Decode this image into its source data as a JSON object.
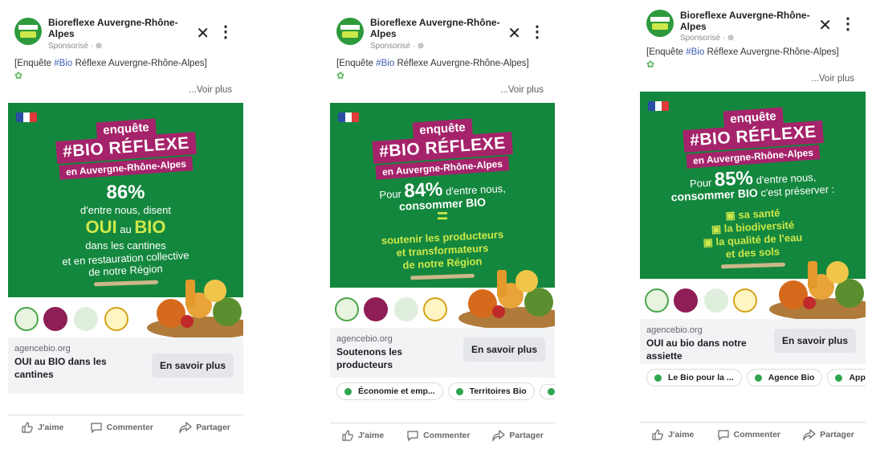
{
  "page_name": "Bioreflexe Auvergne-Rhône-Alpes",
  "sponsored": "Sponsorisé · ⊕",
  "post_text_prefix": "[Enquête ",
  "post_text_hashtag": "#Bio",
  "post_text_suffix": " Réflexe Auvergne-Rhône-Alpes]",
  "see_more": "...Voir plus",
  "close_glyph": "✕",
  "menu_glyph": "⋮",
  "leaf_glyph": "✿",
  "ad_common": {
    "enquete": "enquête",
    "bio_reflexe": "#BIO RÉFLEXE",
    "region": "en Auvergne-Rhône-Alpes"
  },
  "cards": [
    {
      "ad": {
        "percent": "86%",
        "l1": "d'entre nous, disent",
        "oui": "OUI",
        "au": "au",
        "bio": "BIO",
        "l3": "dans les cantines",
        "l4": "et en restauration collective",
        "l5": "de notre Région"
      },
      "link": {
        "domain": "agencebio.org",
        "headline": "OUI au BIO dans les cantines",
        "cta": "En savoir plus"
      }
    },
    {
      "ad": {
        "pour": "Pour",
        "percent": "84%",
        "l1": "d'entre nous,",
        "l2": "consommer BIO",
        "equals": "=",
        "g1": "soutenir les producteurs",
        "g2": "et transformateurs",
        "g3": "de notre Région"
      },
      "link": {
        "domain": "agencebio.org",
        "headline": "Soutenons les producteurs",
        "cta": "En savoir plus"
      },
      "chips": [
        "Économie et emp...",
        "Territoires Bio",
        ""
      ]
    },
    {
      "ad": {
        "pour": "Pour",
        "percent": "85%",
        "l1": "d'entre nous,",
        "l2": "consommer BIO",
        "l2b": "c'est préserver :",
        "b1": "sa santé",
        "b2": "la biodiversité",
        "b3": "la qualité de l'eau",
        "b4": "et des sols"
      },
      "link": {
        "domain": "agencebio.org",
        "headline": "OUI au bio dans notre assiette",
        "cta": "En savoir plus"
      },
      "chips": [
        "Le Bio pour la ...",
        "Agence Bio",
        "Appr"
      ]
    }
  ],
  "actions": {
    "like": "J'aime",
    "comment": "Commenter",
    "share": "Partager"
  },
  "colors": {
    "ad_green": "#14873e",
    "magenta": "#a5236a",
    "lime": "#cde84a"
  }
}
